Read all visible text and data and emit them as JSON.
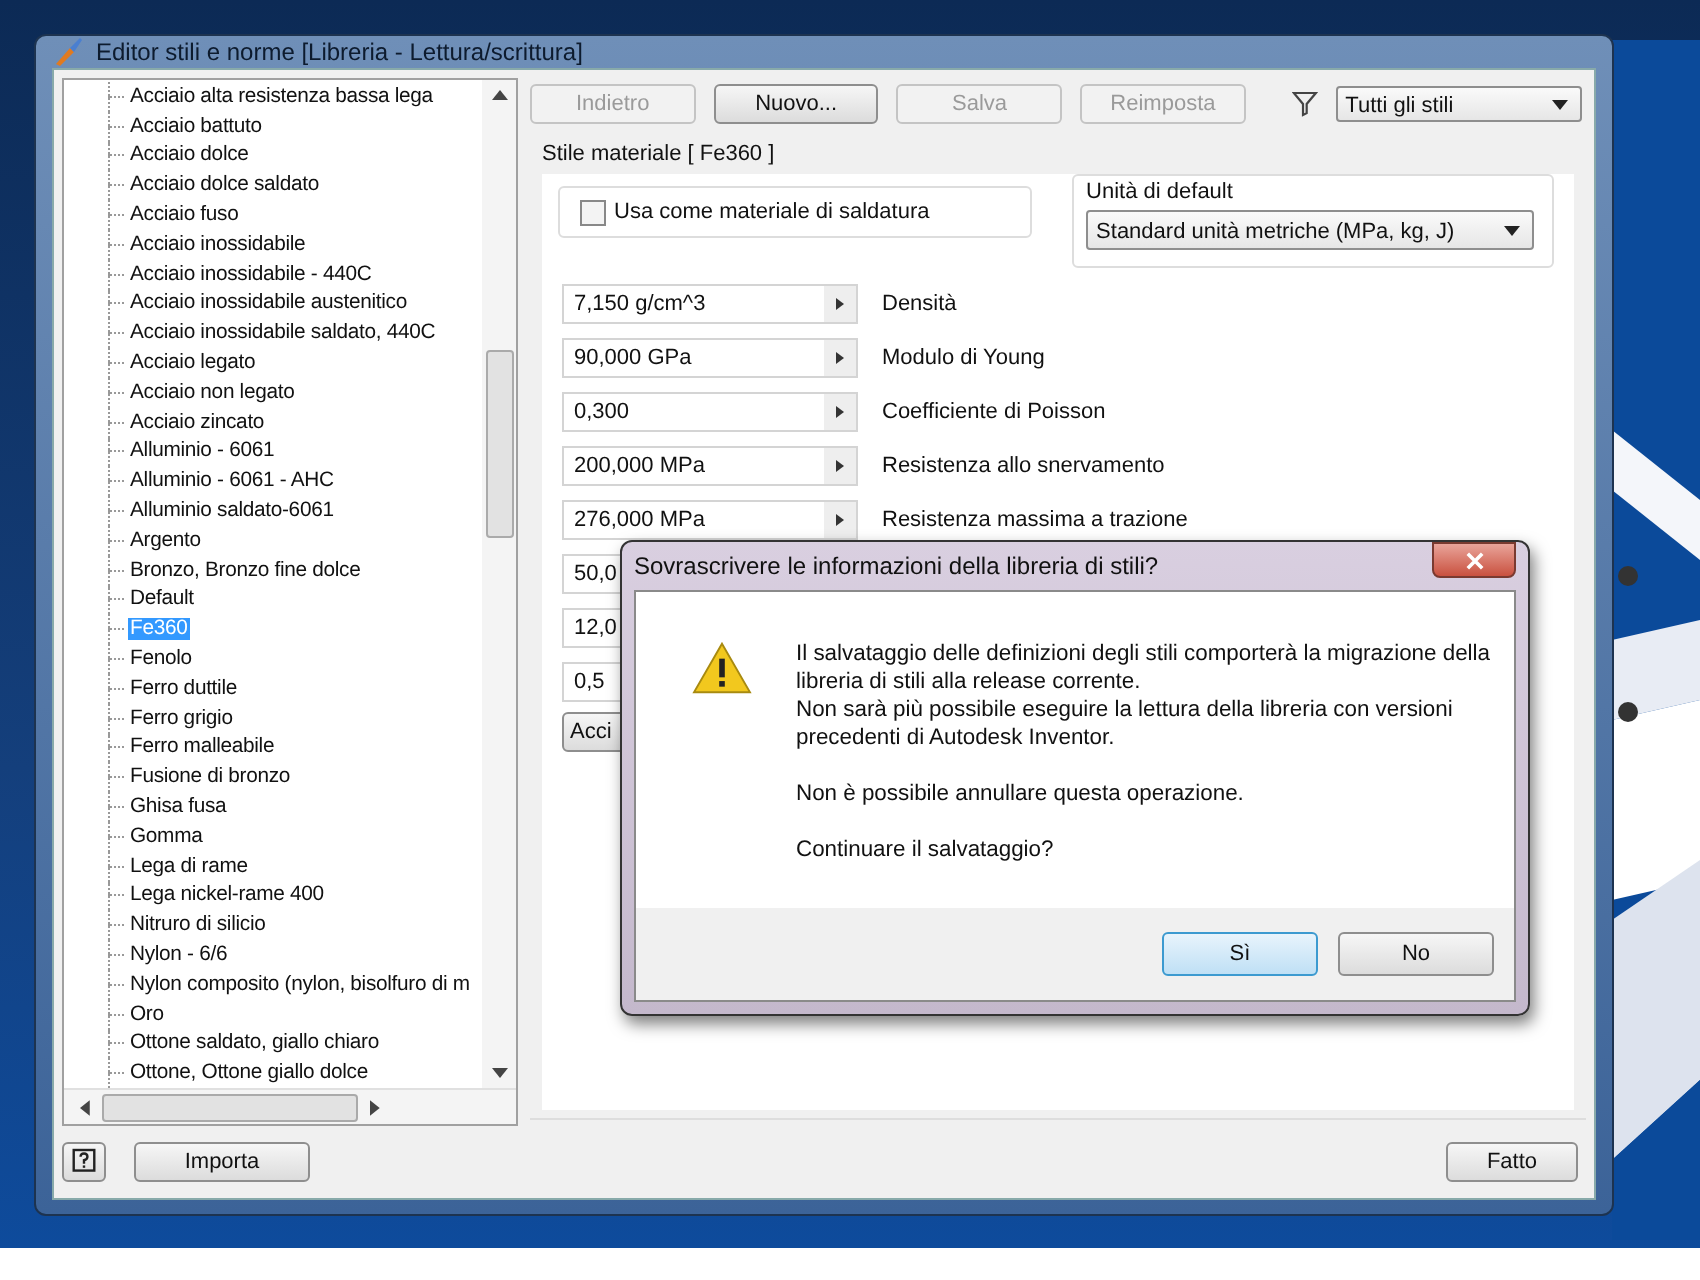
{
  "window": {
    "title": "Editor stili e norme [Libreria - Lettura/scrittura]"
  },
  "tree": {
    "items": [
      {
        "label": "Acciaio alta resistenza bassa lega",
        "selected": false
      },
      {
        "label": "Acciaio battuto",
        "selected": false
      },
      {
        "label": "Acciaio dolce",
        "selected": false
      },
      {
        "label": "Acciaio dolce saldato",
        "selected": false
      },
      {
        "label": "Acciaio fuso",
        "selected": false
      },
      {
        "label": "Acciaio inossidabile",
        "selected": false
      },
      {
        "label": "Acciaio inossidabile - 440C",
        "selected": false
      },
      {
        "label": "Acciaio inossidabile austenitico",
        "selected": false
      },
      {
        "label": "Acciaio inossidabile saldato, 440C",
        "selected": false
      },
      {
        "label": "Acciaio legato",
        "selected": false
      },
      {
        "label": "Acciaio non legato",
        "selected": false
      },
      {
        "label": "Acciaio zincato",
        "selected": false
      },
      {
        "label": "Alluminio - 6061",
        "selected": false
      },
      {
        "label": "Alluminio - 6061 - AHC",
        "selected": false
      },
      {
        "label": "Alluminio saldato-6061",
        "selected": false
      },
      {
        "label": "Argento",
        "selected": false
      },
      {
        "label": "Bronzo, Bronzo fine dolce",
        "selected": false
      },
      {
        "label": "Default",
        "selected": false
      },
      {
        "label": "Fe360",
        "selected": true
      },
      {
        "label": "Fenolo",
        "selected": false
      },
      {
        "label": "Ferro duttile",
        "selected": false
      },
      {
        "label": "Ferro grigio",
        "selected": false
      },
      {
        "label": "Ferro malleabile",
        "selected": false
      },
      {
        "label": "Fusione di bronzo",
        "selected": false
      },
      {
        "label": "Ghisa fusa",
        "selected": false
      },
      {
        "label": "Gomma",
        "selected": false
      },
      {
        "label": "Lega di rame",
        "selected": false
      },
      {
        "label": "Lega nickel-rame 400",
        "selected": false
      },
      {
        "label": "Nitruro di silicio",
        "selected": false
      },
      {
        "label": "Nylon - 6/6",
        "selected": false
      },
      {
        "label": "Nylon composito (nylon, bisolfuro di m",
        "selected": false
      },
      {
        "label": "Oro",
        "selected": false
      },
      {
        "label": "Ottone saldato, giallo chiaro",
        "selected": false
      },
      {
        "label": "Ottone, Ottone giallo dolce",
        "selected": false
      }
    ]
  },
  "toolbar": {
    "buttons": [
      {
        "label": "Indietro",
        "disabled": true
      },
      {
        "label": "Nuovo...",
        "disabled": false
      },
      {
        "label": "Salva",
        "disabled": true
      },
      {
        "label": "Reimposta",
        "disabled": true
      }
    ],
    "filter": {
      "value": "Tutti gli stili"
    }
  },
  "style_panel": {
    "title": "Stile materiale [ Fe360 ]",
    "weld_checkbox": {
      "label": "Usa come materiale di saldatura",
      "checked": false
    },
    "units": {
      "title": "Unità di default",
      "value": "Standard unità metriche (MPa, kg, J)"
    },
    "properties": [
      {
        "value": "7,150 g/cm^3",
        "label": "Densità"
      },
      {
        "value": "90,000 GPa",
        "label": "Modulo di Young"
      },
      {
        "value": "0,300",
        "label": "Coefficiente di Poisson"
      },
      {
        "value": "200,000 MPa",
        "label": "Resistenza allo snervamento"
      },
      {
        "value": "276,000 MPa",
        "label": "Resistenza massima a trazione"
      },
      {
        "value": "50,0"
      },
      {
        "value": "12,0"
      },
      {
        "value": "0,5"
      }
    ],
    "hidden_button": {
      "label": "Acci"
    }
  },
  "footer": {
    "buttons": [
      {
        "label": "Importa"
      },
      {
        "label": "Fatto"
      }
    ]
  },
  "dialog": {
    "title": "Sovrascrivere le informazioni della libreria di stili?",
    "paragraphs": [
      "Il salvataggio delle definizioni degli stili comporterà la migrazione della libreria di stili alla release corrente.\nNon sarà più possibile eseguire la lettura della libreria con versioni precedenti di Autodesk Inventor.",
      "Non è possibile annullare questa operazione.",
      "Continuare il salvataggio?"
    ],
    "buttons": [
      {
        "label": "Sì",
        "default": true
      },
      {
        "label": "No",
        "default": false
      }
    ]
  }
}
